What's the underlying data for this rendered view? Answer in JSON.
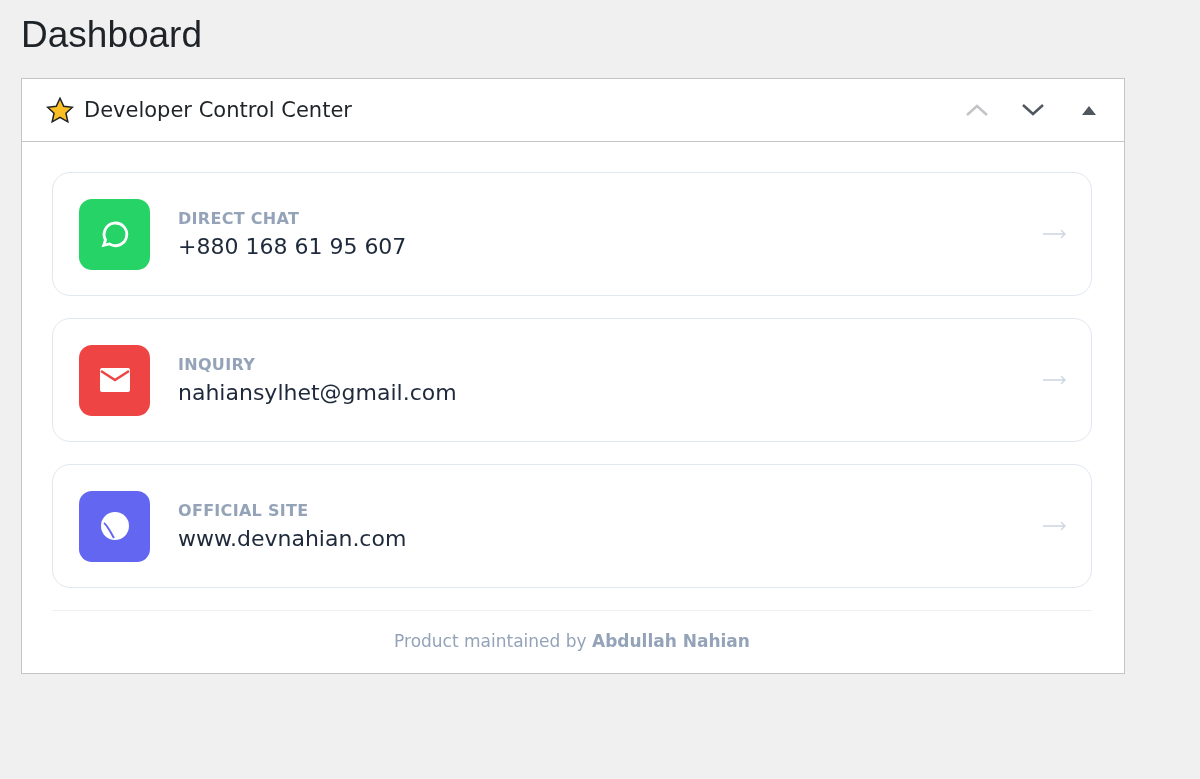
{
  "page_title": "Dashboard",
  "widget": {
    "title": "Developer Control Center",
    "controls": [
      {
        "kind": "up",
        "disabled": true
      },
      {
        "kind": "down",
        "disabled": false
      },
      {
        "kind": "toggle",
        "disabled": false
      }
    ],
    "contacts": [
      {
        "kind": "chat",
        "label": "DIRECT CHAT",
        "value": "+880 168 61 95 607",
        "color": "#25d366"
      },
      {
        "kind": "mail",
        "label": "INQUIRY",
        "value": "nahiansylhet@gmail.com",
        "color": "#ef4444"
      },
      {
        "kind": "site",
        "label": "OFFICIAL SITE",
        "value": "www.devnahian.com",
        "color": "#6366f1"
      }
    ],
    "footer": "Product maintained by **Abdullah Nahian**"
  }
}
